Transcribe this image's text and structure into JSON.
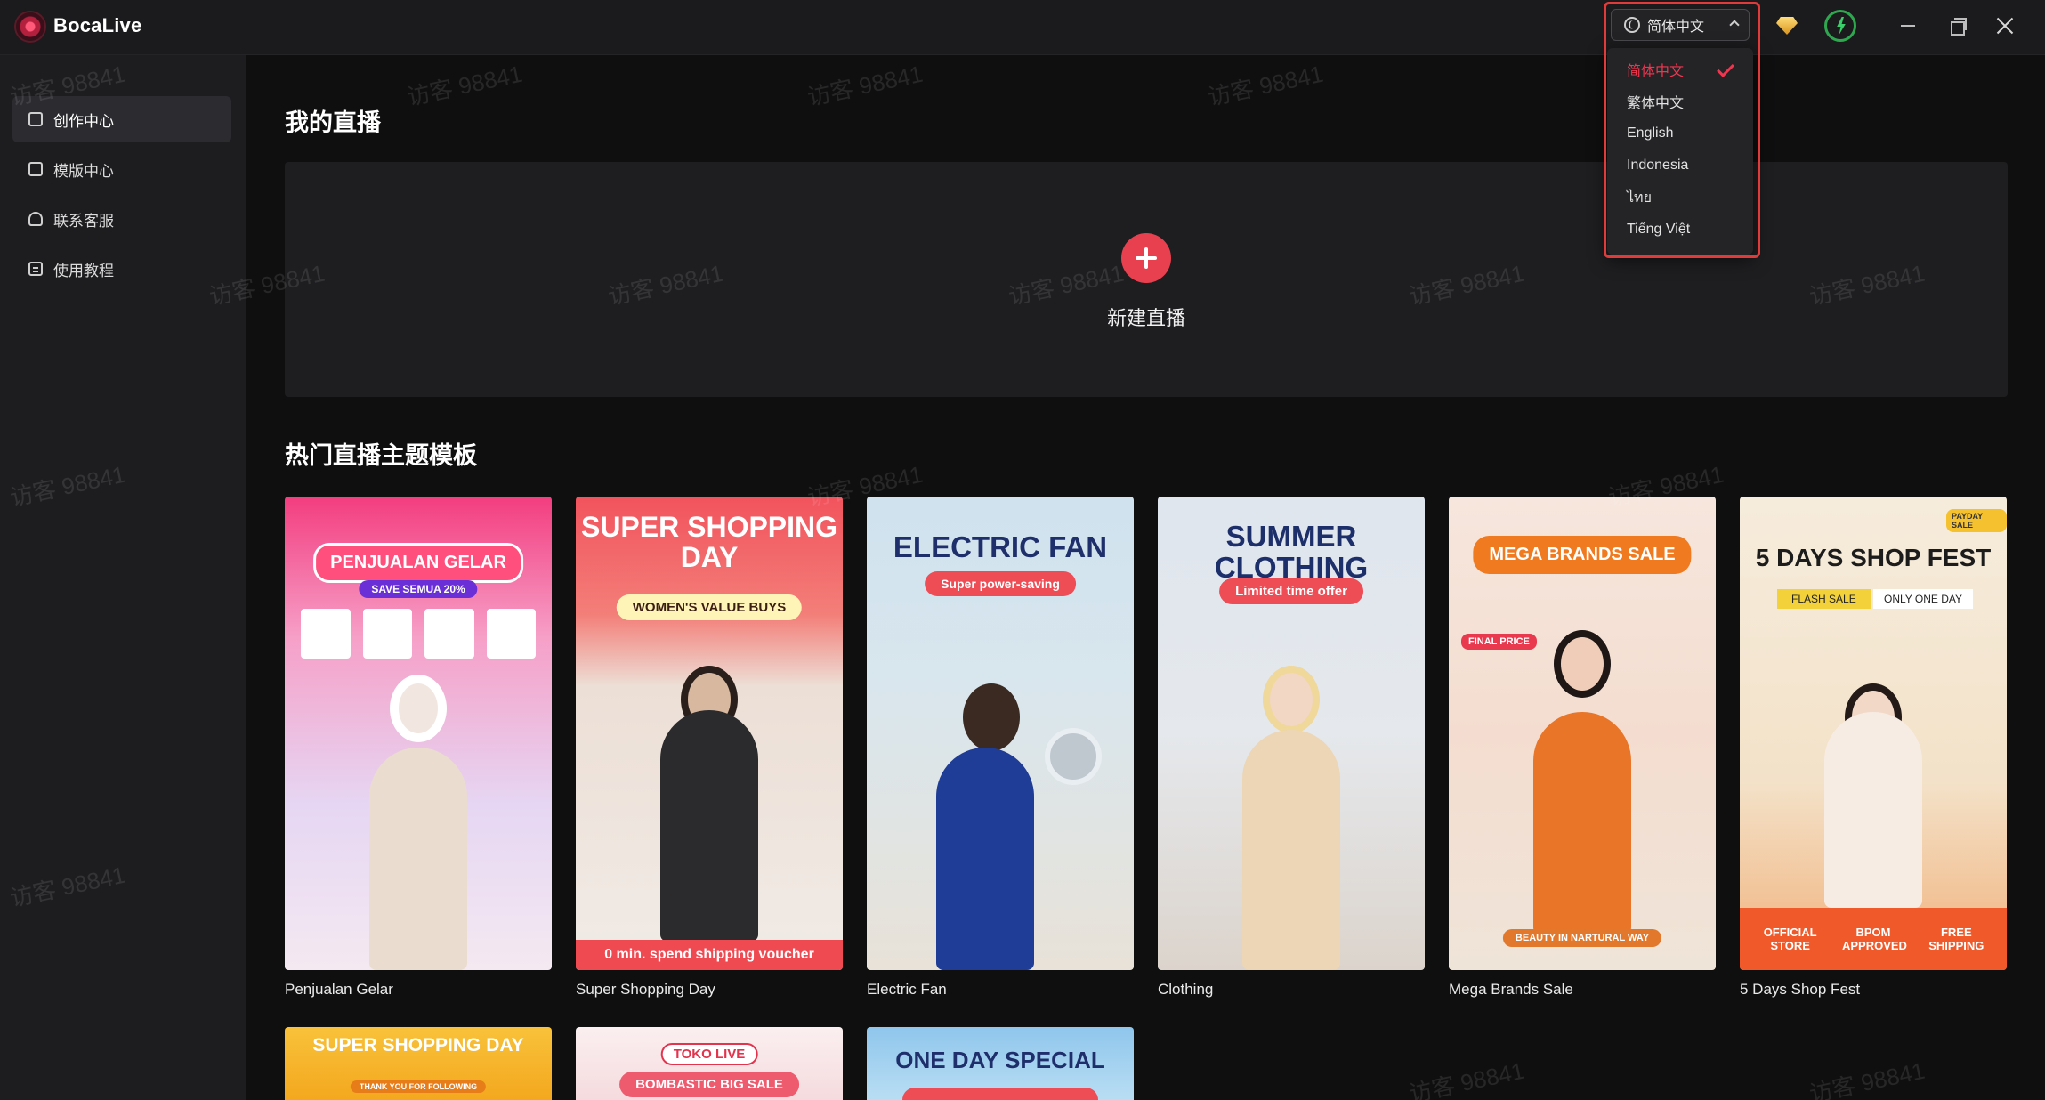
{
  "app": {
    "name": "BocaLive"
  },
  "header": {
    "language_button_label": "简体中文",
    "language_options": [
      {
        "label": "简体中文",
        "selected": true
      },
      {
        "label": "繁体中文",
        "selected": false
      },
      {
        "label": "English",
        "selected": false
      },
      {
        "label": "Indonesia",
        "selected": false
      },
      {
        "label": "ไทย",
        "selected": false
      },
      {
        "label": "Tiếng Việt",
        "selected": false
      }
    ],
    "icons": [
      "globe-icon",
      "vip-gem-icon",
      "power-icon",
      "minimize-icon",
      "maximize-icon",
      "close-icon"
    ]
  },
  "sidebar": {
    "items": [
      {
        "label": "创作中心",
        "active": true,
        "icon": "studio-icon"
      },
      {
        "label": "模版中心",
        "active": false,
        "icon": "template-icon"
      },
      {
        "label": "联系客服",
        "active": false,
        "icon": "headset-icon"
      },
      {
        "label": "使用教程",
        "active": false,
        "icon": "book-icon"
      }
    ]
  },
  "main": {
    "my_live_title": "我的直播",
    "new_live_label": "新建直播",
    "templates_title": "热门直播主题模板",
    "templates": [
      {
        "name": "Penjualan Gelar",
        "headline": "PENJUALAN GELAR",
        "sub": "SAVE SEMUA 20%"
      },
      {
        "name": "Super Shopping Day",
        "headline": "SUPER SHOPPING DAY",
        "sub": "WOMEN'S VALUE BUYS",
        "footer": "0 min. spend shipping voucher"
      },
      {
        "name": "Electric Fan",
        "headline": "ELECTRIC FAN",
        "sub": "Super power-saving"
      },
      {
        "name": "Clothing",
        "headline": "SUMMER CLOTHING",
        "sub": "Limited time offer"
      },
      {
        "name": "Mega Brands Sale",
        "headline": "MEGA BRANDS SALE",
        "sub": "FINAL PRICE",
        "footer": "BEAUTY IN NARTURAL WAY"
      },
      {
        "name": "5 Days Shop Fest",
        "headline": "5 DAYS SHOP FEST",
        "sub": "FLASH SALE",
        "sub2": "ONLY ONE DAY",
        "badge": "PAYDAY SALE",
        "footer_items": [
          "OFFICIAL STORE",
          "BPOM APPROVED",
          "FREE SHIPPING"
        ]
      }
    ],
    "more_templates": [
      {
        "headline": "SUPER SHOPPING DAY",
        "sub": "THANK YOU FOR FOLLOWING"
      },
      {
        "headline": "TOKO LIVE",
        "sub": "BOMBASTIC BIG SALE"
      },
      {
        "headline": "ONE DAY SPECIAL"
      }
    ]
  },
  "watermark": "访客 98841",
  "colors": {
    "accent": "#e8404f",
    "selected_text": "#f0364f",
    "background": "#0f0f10",
    "sidebar": "#1d1d20"
  }
}
